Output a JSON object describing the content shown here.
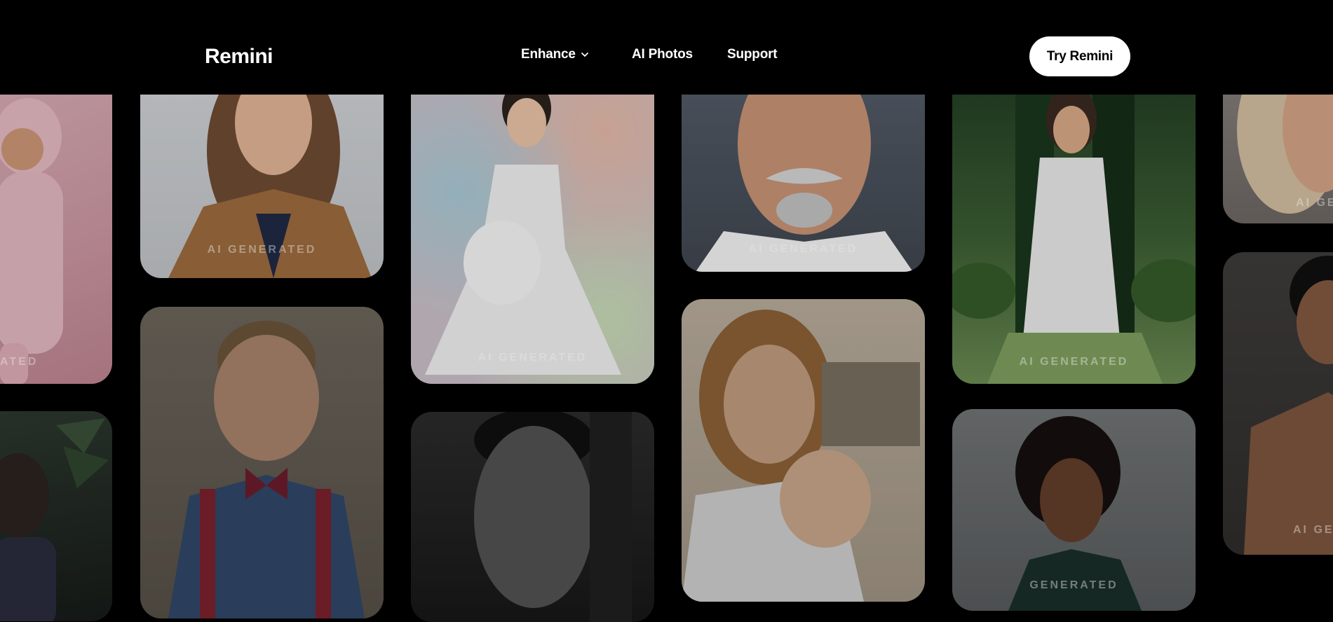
{
  "header": {
    "logo": "Remini",
    "nav": {
      "enhance": "Enhance",
      "ai_photos": "AI Photos",
      "support": "Support"
    },
    "cta": "Try Remini"
  },
  "gallery": {
    "watermark": "AI GENERATED",
    "cards": [
      {
        "name": "toddler-pink-costume",
        "watermark": "ATED"
      },
      {
        "name": "woman-brown-blazer",
        "watermark": "AI GENERATED"
      },
      {
        "name": "pregnant-woman-white-dress",
        "watermark": "AI GENERATED"
      },
      {
        "name": "older-man-portrait",
        "watermark": "AI GENERATED"
      },
      {
        "name": "bride-garden",
        "watermark": "AI GENERATED"
      },
      {
        "name": "blonde-woman-partial",
        "watermark": "AI GE"
      },
      {
        "name": "girl-palm-leaves",
        "watermark": ""
      },
      {
        "name": "boy-bowtie-suspenders",
        "watermark": ""
      },
      {
        "name": "man-black-and-white",
        "watermark": ""
      },
      {
        "name": "mother-with-baby",
        "watermark": ""
      },
      {
        "name": "woman-curly-hair-beach",
        "watermark": "GENERATED"
      },
      {
        "name": "shirtless-man",
        "watermark": "AI GE"
      }
    ]
  },
  "colors": {
    "background": "#000000",
    "cta_bg": "#ffffff",
    "cta_text": "#000000"
  }
}
